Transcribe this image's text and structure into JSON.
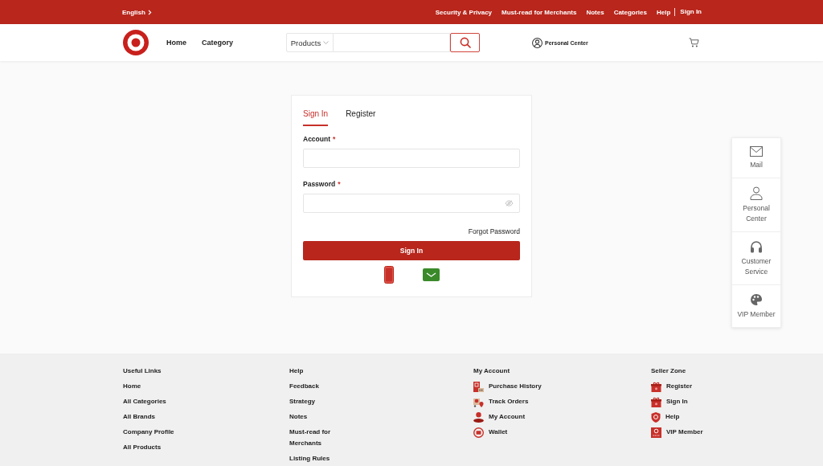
{
  "top_bar": {
    "language": "English",
    "links": [
      "Security & Privacy",
      "Must-read for Merchants",
      "Notes",
      "Categories",
      "Help"
    ],
    "auth_link": "Sign In"
  },
  "header": {
    "nav": [
      "Home",
      "Category"
    ],
    "search": {
      "scope": "Products"
    },
    "account_link": "Personal Center"
  },
  "login": {
    "tabs": [
      {
        "label": "Sign In",
        "selected": true
      },
      {
        "label": "Register",
        "selected": false
      }
    ],
    "fields": [
      {
        "label": "Account",
        "mark": "*",
        "kind": "text"
      },
      {
        "label": "Password",
        "mark": "*",
        "kind": "password"
      }
    ],
    "forgot_link": "Forgot Password",
    "submit": "Sign In"
  },
  "side_panel": {
    "items": [
      "Mail",
      "Personal Center",
      "Customer Service",
      "VIP Member"
    ]
  },
  "footer": {
    "columns": [
      {
        "title": "Useful Links",
        "kind": "plain",
        "links": [
          "Home",
          "All Categories",
          "All Brands",
          "Company Profile",
          "All Products"
        ]
      },
      {
        "title": "Help",
        "kind": "plain",
        "links": [
          "Feedback",
          "Strategy",
          "Notes",
          "Must-read for Merchants",
          "Listing Rules"
        ]
      },
      {
        "title": "My Account",
        "kind": "icons",
        "links": [
          "Purchase History",
          "Track Orders",
          "My Account",
          "Wallet"
        ]
      },
      {
        "title": "Seller Zone",
        "kind": "icons",
        "links": [
          "Register",
          "Sign In",
          "Help",
          "VIP Member"
        ]
      }
    ]
  }
}
